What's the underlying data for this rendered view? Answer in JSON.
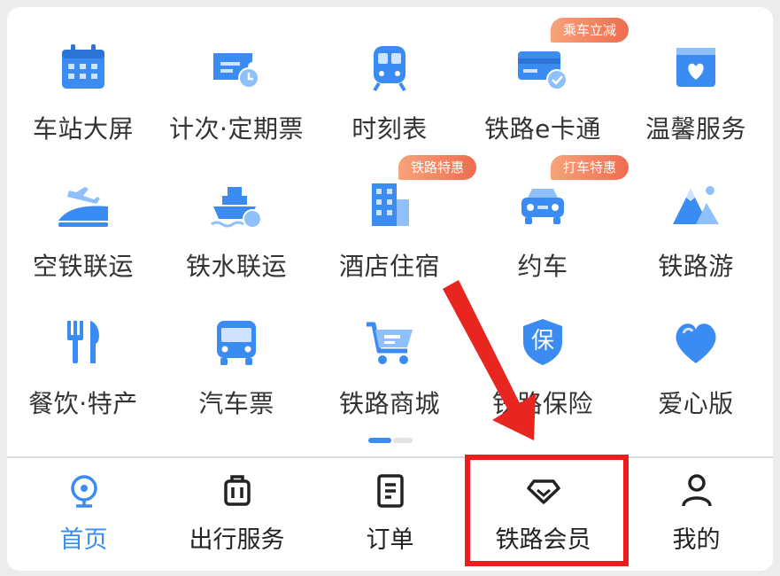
{
  "grid": {
    "row1": [
      {
        "label": "车站大屏",
        "icon": "calendar-icon"
      },
      {
        "label": "计次·定期票",
        "icon": "ticket-clock-icon"
      },
      {
        "label": "时刻表",
        "icon": "train-front-icon"
      },
      {
        "label": "铁路e卡通",
        "icon": "rail-card-icon",
        "badge": "乘车立减"
      },
      {
        "label": "温馨服务",
        "icon": "heart-box-icon"
      }
    ],
    "row2": [
      {
        "label": "空铁联运",
        "icon": "plane-train-icon"
      },
      {
        "label": "铁水联运",
        "icon": "ship-icon"
      },
      {
        "label": "酒店住宿",
        "icon": "hotel-building-icon",
        "badge": "铁路特惠"
      },
      {
        "label": "约车",
        "icon": "car-icon",
        "badge": "打车特惠"
      },
      {
        "label": "铁路游",
        "icon": "mountain-icon"
      }
    ],
    "row3": [
      {
        "label": "餐饮·特产",
        "icon": "fork-knife-icon"
      },
      {
        "label": "汽车票",
        "icon": "bus-icon"
      },
      {
        "label": "铁路商城",
        "icon": "shopping-cart-icon"
      },
      {
        "label": "铁路保险",
        "icon": "shield-bao-icon",
        "glyph": "保"
      },
      {
        "label": "爱心版",
        "icon": "heart-icon"
      }
    ]
  },
  "tabbar": {
    "items": [
      {
        "label": "首页",
        "icon": "home-train-icon",
        "active": true
      },
      {
        "label": "出行服务",
        "icon": "luggage-icon"
      },
      {
        "label": "订单",
        "icon": "order-doc-icon"
      },
      {
        "label": "铁路会员",
        "icon": "diamond-icon"
      },
      {
        "label": "我的",
        "icon": "user-icon"
      }
    ]
  },
  "colors": {
    "primary": "#3a8bf2",
    "icon_light": "#8ec0fb",
    "badge_start": "#f7a37a",
    "badge_end": "#ef6b4f",
    "annotation_red": "#ee1c1c",
    "text": "#333333"
  }
}
